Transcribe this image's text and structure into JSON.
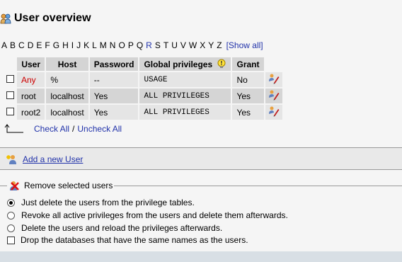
{
  "header": {
    "title": "User overview",
    "icon": "users-icon"
  },
  "alphabet": {
    "letters": [
      "A",
      "B",
      "C",
      "D",
      "E",
      "F",
      "G",
      "H",
      "I",
      "J",
      "K",
      "L",
      "M",
      "N",
      "O",
      "P",
      "Q",
      "R",
      "S",
      "T",
      "U",
      "V",
      "W",
      "X",
      "Y",
      "Z"
    ],
    "linked": [
      "R"
    ],
    "show_all": "[Show all]"
  },
  "table": {
    "columns": [
      "User",
      "Host",
      "Password",
      "Global privileges",
      "Grant"
    ],
    "rows": [
      {
        "user": "Any",
        "host": "%",
        "password": "--",
        "privileges": "USAGE",
        "grant": "No"
      },
      {
        "user": "root",
        "host": "localhost",
        "password": "Yes",
        "privileges": "ALL PRIVILEGES",
        "grant": "Yes"
      },
      {
        "user": "root2",
        "host": "localhost",
        "password": "Yes",
        "privileges": "ALL PRIVILEGES",
        "grant": "Yes"
      }
    ]
  },
  "bulk": {
    "check_all": "Check All",
    "separator": "/",
    "uncheck_all": "Uncheck All"
  },
  "add_user": {
    "label": "Add a new User"
  },
  "remove": {
    "legend": "Remove selected users",
    "options": [
      {
        "label": "Just delete the users from the privilege tables.",
        "selected": true
      },
      {
        "label": "Revoke all active privileges from the users and delete them afterwards.",
        "selected": false
      },
      {
        "label": "Delete the users and reload the privileges afterwards.",
        "selected": false
      }
    ],
    "drop_db_label": "Drop the databases that have the same names as the users."
  },
  "colors": {
    "link": "#2233aa",
    "anonymous_user": "#cc0000",
    "header_bg": "#d4d4d4"
  }
}
